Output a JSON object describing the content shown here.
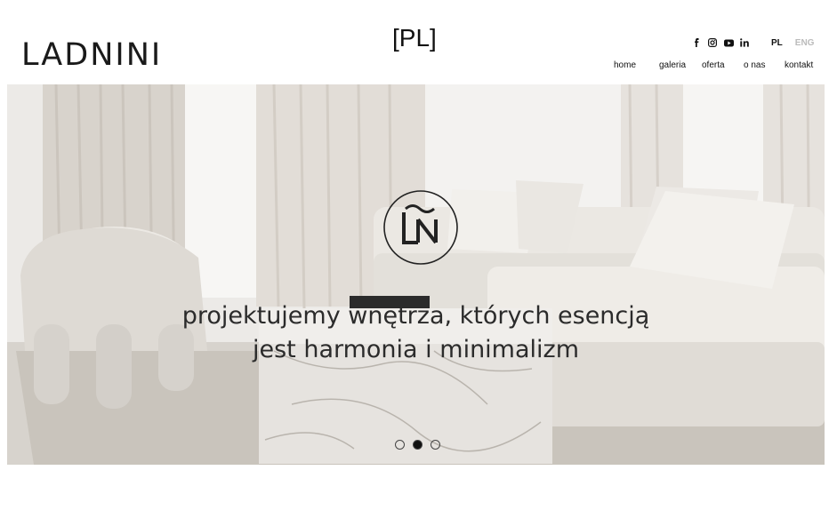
{
  "header": {
    "brand": "LADNINI",
    "lang_tag": "[PL]",
    "social": [
      {
        "icon": "facebook-icon",
        "glyph": "f"
      },
      {
        "icon": "instagram-icon",
        "glyph": "◙"
      },
      {
        "icon": "youtube-icon",
        "glyph": "▶"
      },
      {
        "icon": "linkedin-icon",
        "glyph": "in"
      }
    ],
    "languages": {
      "pl": "PL",
      "eng": "ENG"
    },
    "nav": [
      "home",
      "galeria",
      "oferta",
      "o nas",
      "kontakt"
    ]
  },
  "hero": {
    "monogram": "ŁÑ",
    "tagline_line1": "projektujemy wnętrza, których esencją",
    "tagline_line2": "jest harmonia i minimalizm",
    "slides": 3,
    "active_slide": 2
  },
  "colors": {
    "eng_inactive": "#bbbbbb",
    "text": "#111111"
  }
}
